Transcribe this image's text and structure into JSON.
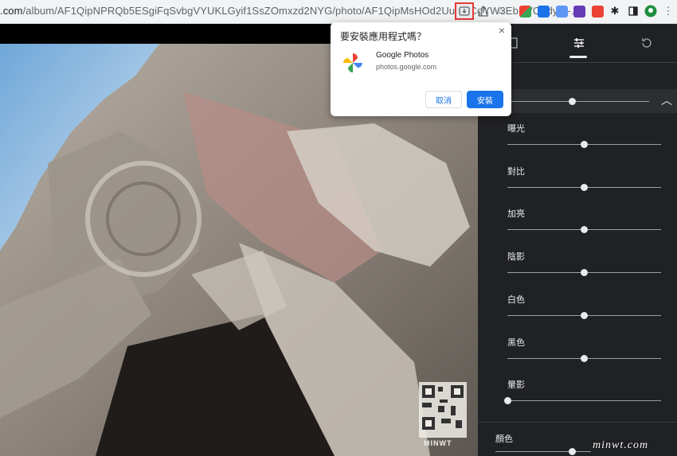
{
  "browser": {
    "url_domain": ".com",
    "url_path": "/album/AF1QipNPRQb5ESgiFqSvbgVYUKLGyif1SsZOmxzd2NYG/photo/AF1QipMsHOd2UurGtCgYW3EbRVOgdyW-..."
  },
  "install_popup": {
    "title": "要安裝應用程式嗎？",
    "app_name": "Google Photos",
    "app_url": "photos.google.com",
    "cancel_label": "取消",
    "install_label": "安裝"
  },
  "editor_panel": {
    "sliders": [
      {
        "label": "曝光",
        "value": 0.5
      },
      {
        "label": "對比",
        "value": 0.5
      },
      {
        "label": "加亮",
        "value": 0.5
      },
      {
        "label": "陰影",
        "value": 0.5
      },
      {
        "label": "白色",
        "value": 0.5
      },
      {
        "label": "黑色",
        "value": 0.5
      },
      {
        "label": "暈影",
        "value": 0.0
      }
    ],
    "color_section_label": "顏色"
  },
  "overlay": {
    "qr_label": "MINWT",
    "watermark": "minwt.com"
  },
  "colors": {
    "accent": "#1a73e8",
    "panel_bg": "#202124",
    "highlight": "#e53935"
  },
  "icons": [
    "install-app-icon",
    "share-icon",
    "star-icon",
    "extensions-icon",
    "close-icon",
    "google-photos-logo",
    "tune-icon",
    "rotate-icon",
    "chevron-up-icon"
  ]
}
